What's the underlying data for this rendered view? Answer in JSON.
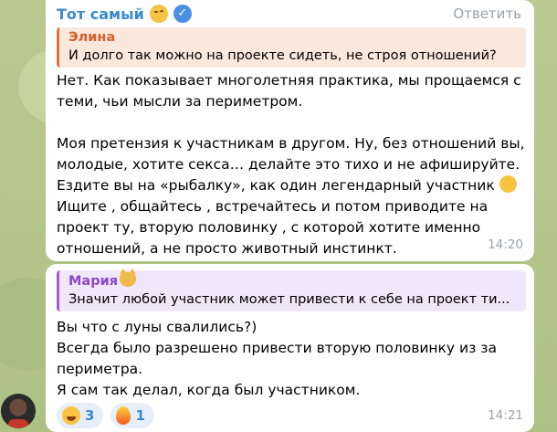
{
  "message1": {
    "sender": "Тот самый",
    "reply_label": "Ответить",
    "quote": {
      "name": "Элина",
      "text": "И долго так можно на проекте сидеть, не строя отношений?"
    },
    "body_part1": "Нет. Как показывает многолетняя практика, мы прощаемся с теми, чьи мысли за периметром.\n\nМоя претензия к участникам в другом. Ну, без отношений вы, молодые, хотите секса… делайте это тихо и не афишируйте. Ездите вы на «рыбалку», как один легендарный участник ",
    "body_part2": "\nИщите , общайтесь , встречайтесь и потом приводите на проект ту, вторую половинку , с которой хотите именно отношений, а не просто животный инстинкт.",
    "time": "14:20"
  },
  "message2": {
    "quote": {
      "name": "Мария",
      "text": "Значит любой участник может привести к себе на проект ти..."
    },
    "body": "Вы что с луны свалились?)\nВсегда было разрешено привести вторую половинку из за периметра.\nЯ сам так делал, когда был участником.",
    "reactions": [
      {
        "icon": "laughing-emoji",
        "count": "3"
      },
      {
        "icon": "fire-emoji",
        "count": "1"
      }
    ],
    "time": "14:21"
  }
}
